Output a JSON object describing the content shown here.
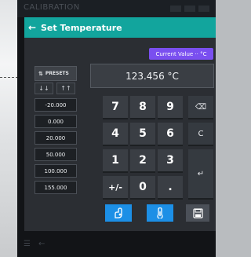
{
  "statusbar": {
    "title": "CALIBRATION"
  },
  "dialog": {
    "title": "Set Temperature",
    "current_value_badge": "Current Value ·· °C",
    "display_value": "123.456 °C"
  },
  "presets": {
    "header": "PRESETS",
    "sort_asc": "↓↓",
    "sort_desc": "↑↑",
    "items": [
      "-20.000",
      "0.000",
      "20.000",
      "50.000",
      "100.000",
      "155.000"
    ]
  },
  "keypad": {
    "keys": [
      "7",
      "8",
      "9",
      "4",
      "5",
      "6",
      "1",
      "2",
      "3",
      "+/-",
      "0",
      "."
    ],
    "backspace": "⌫",
    "clear": "C",
    "enter": "↵"
  },
  "actions": {
    "icons": [
      "hand-thermometer-icon",
      "thermometer-gauge-icon",
      "save-icon"
    ]
  },
  "colors": {
    "accent": "#12a59d",
    "badge": "#7a4ff0",
    "action": "#1c8fe6"
  }
}
